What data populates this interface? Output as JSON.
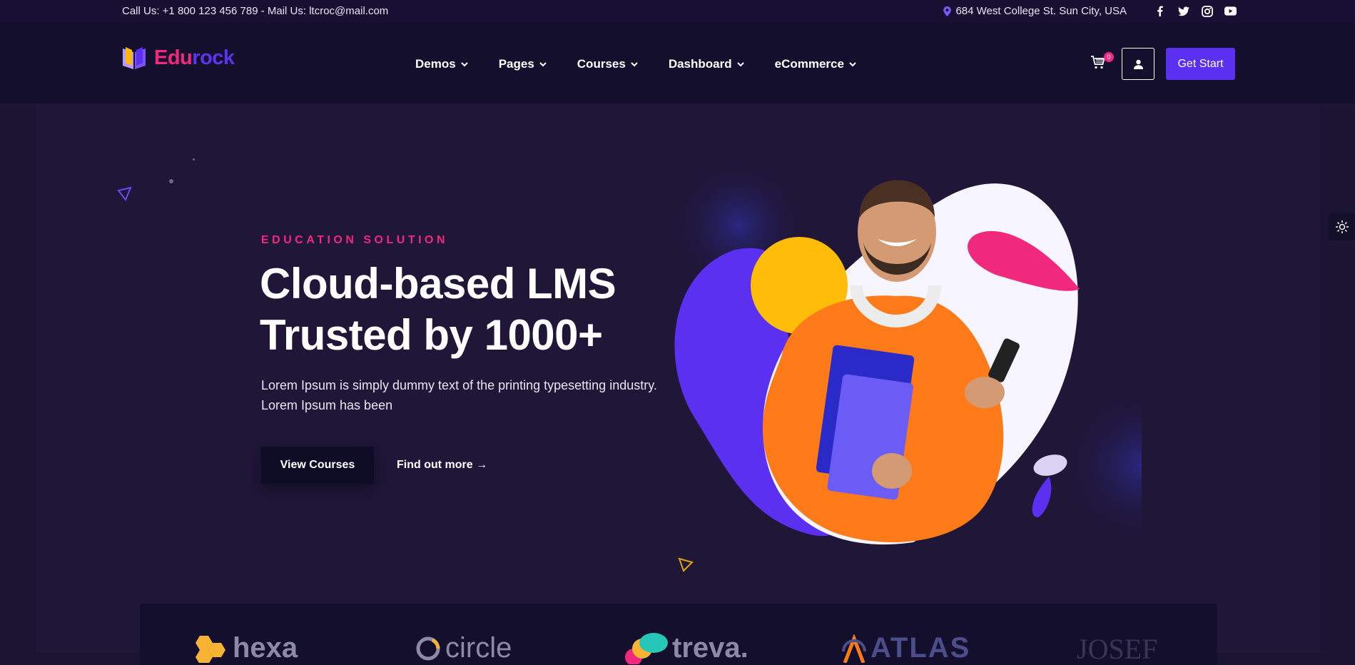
{
  "topbar": {
    "contact": "Call Us: +1 800 123 456 789 - Mail Us: ltcroc@mail.com",
    "address": "684 West College St. Sun City, USA",
    "socials": [
      "facebook-icon",
      "twitter-icon",
      "instagram-icon",
      "youtube-icon"
    ]
  },
  "logo": {
    "part1": "Edu",
    "part2": "rock"
  },
  "nav": {
    "items": [
      {
        "label": "Demos"
      },
      {
        "label": "Pages"
      },
      {
        "label": "Courses"
      },
      {
        "label": "Dashboard"
      },
      {
        "label": "eCommerce"
      }
    ],
    "cart_count": "0",
    "cta_label": "Get Start"
  },
  "hero": {
    "eyebrow": "EDUCATION SOLUTION",
    "headline_line1": "Cloud-based LMS",
    "headline_line2": "Trusted by 1000+",
    "lead": "Lorem Ipsum is simply dummy text of the printing typesetting industry. Lorem Ipsum has been",
    "primary_button": "View Courses",
    "secondary_link": "Find out more →"
  },
  "brands": {
    "items": [
      {
        "name": "hexa"
      },
      {
        "name": "circle"
      },
      {
        "name": "treva."
      },
      {
        "name": "ATLAS"
      },
      {
        "name": "JOSEF"
      }
    ]
  },
  "colors": {
    "accent": "#5b30f0",
    "pink": "#f0287e",
    "yellow": "#ffb703",
    "orange": "#ff7b17",
    "background": "#1f1638"
  }
}
